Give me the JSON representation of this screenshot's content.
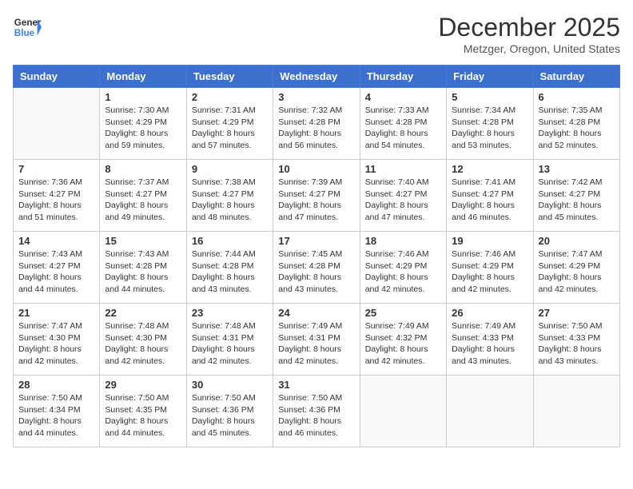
{
  "header": {
    "logo_line1": "General",
    "logo_line2": "Blue",
    "month_title": "December 2025",
    "location": "Metzger, Oregon, United States"
  },
  "days_of_week": [
    "Sunday",
    "Monday",
    "Tuesday",
    "Wednesday",
    "Thursday",
    "Friday",
    "Saturday"
  ],
  "weeks": [
    [
      {
        "day": "",
        "sunrise": "",
        "sunset": "",
        "daylight": ""
      },
      {
        "day": "1",
        "sunrise": "Sunrise: 7:30 AM",
        "sunset": "Sunset: 4:29 PM",
        "daylight": "Daylight: 8 hours and 59 minutes."
      },
      {
        "day": "2",
        "sunrise": "Sunrise: 7:31 AM",
        "sunset": "Sunset: 4:29 PM",
        "daylight": "Daylight: 8 hours and 57 minutes."
      },
      {
        "day": "3",
        "sunrise": "Sunrise: 7:32 AM",
        "sunset": "Sunset: 4:28 PM",
        "daylight": "Daylight: 8 hours and 56 minutes."
      },
      {
        "day": "4",
        "sunrise": "Sunrise: 7:33 AM",
        "sunset": "Sunset: 4:28 PM",
        "daylight": "Daylight: 8 hours and 54 minutes."
      },
      {
        "day": "5",
        "sunrise": "Sunrise: 7:34 AM",
        "sunset": "Sunset: 4:28 PM",
        "daylight": "Daylight: 8 hours and 53 minutes."
      },
      {
        "day": "6",
        "sunrise": "Sunrise: 7:35 AM",
        "sunset": "Sunset: 4:28 PM",
        "daylight": "Daylight: 8 hours and 52 minutes."
      }
    ],
    [
      {
        "day": "7",
        "sunrise": "Sunrise: 7:36 AM",
        "sunset": "Sunset: 4:27 PM",
        "daylight": "Daylight: 8 hours and 51 minutes."
      },
      {
        "day": "8",
        "sunrise": "Sunrise: 7:37 AM",
        "sunset": "Sunset: 4:27 PM",
        "daylight": "Daylight: 8 hours and 49 minutes."
      },
      {
        "day": "9",
        "sunrise": "Sunrise: 7:38 AM",
        "sunset": "Sunset: 4:27 PM",
        "daylight": "Daylight: 8 hours and 48 minutes."
      },
      {
        "day": "10",
        "sunrise": "Sunrise: 7:39 AM",
        "sunset": "Sunset: 4:27 PM",
        "daylight": "Daylight: 8 hours and 47 minutes."
      },
      {
        "day": "11",
        "sunrise": "Sunrise: 7:40 AM",
        "sunset": "Sunset: 4:27 PM",
        "daylight": "Daylight: 8 hours and 47 minutes."
      },
      {
        "day": "12",
        "sunrise": "Sunrise: 7:41 AM",
        "sunset": "Sunset: 4:27 PM",
        "daylight": "Daylight: 8 hours and 46 minutes."
      },
      {
        "day": "13",
        "sunrise": "Sunrise: 7:42 AM",
        "sunset": "Sunset: 4:27 PM",
        "daylight": "Daylight: 8 hours and 45 minutes."
      }
    ],
    [
      {
        "day": "14",
        "sunrise": "Sunrise: 7:43 AM",
        "sunset": "Sunset: 4:27 PM",
        "daylight": "Daylight: 8 hours and 44 minutes."
      },
      {
        "day": "15",
        "sunrise": "Sunrise: 7:43 AM",
        "sunset": "Sunset: 4:28 PM",
        "daylight": "Daylight: 8 hours and 44 minutes."
      },
      {
        "day": "16",
        "sunrise": "Sunrise: 7:44 AM",
        "sunset": "Sunset: 4:28 PM",
        "daylight": "Daylight: 8 hours and 43 minutes."
      },
      {
        "day": "17",
        "sunrise": "Sunrise: 7:45 AM",
        "sunset": "Sunset: 4:28 PM",
        "daylight": "Daylight: 8 hours and 43 minutes."
      },
      {
        "day": "18",
        "sunrise": "Sunrise: 7:46 AM",
        "sunset": "Sunset: 4:29 PM",
        "daylight": "Daylight: 8 hours and 42 minutes."
      },
      {
        "day": "19",
        "sunrise": "Sunrise: 7:46 AM",
        "sunset": "Sunset: 4:29 PM",
        "daylight": "Daylight: 8 hours and 42 minutes."
      },
      {
        "day": "20",
        "sunrise": "Sunrise: 7:47 AM",
        "sunset": "Sunset: 4:29 PM",
        "daylight": "Daylight: 8 hours and 42 minutes."
      }
    ],
    [
      {
        "day": "21",
        "sunrise": "Sunrise: 7:47 AM",
        "sunset": "Sunset: 4:30 PM",
        "daylight": "Daylight: 8 hours and 42 minutes."
      },
      {
        "day": "22",
        "sunrise": "Sunrise: 7:48 AM",
        "sunset": "Sunset: 4:30 PM",
        "daylight": "Daylight: 8 hours and 42 minutes."
      },
      {
        "day": "23",
        "sunrise": "Sunrise: 7:48 AM",
        "sunset": "Sunset: 4:31 PM",
        "daylight": "Daylight: 8 hours and 42 minutes."
      },
      {
        "day": "24",
        "sunrise": "Sunrise: 7:49 AM",
        "sunset": "Sunset: 4:31 PM",
        "daylight": "Daylight: 8 hours and 42 minutes."
      },
      {
        "day": "25",
        "sunrise": "Sunrise: 7:49 AM",
        "sunset": "Sunset: 4:32 PM",
        "daylight": "Daylight: 8 hours and 42 minutes."
      },
      {
        "day": "26",
        "sunrise": "Sunrise: 7:49 AM",
        "sunset": "Sunset: 4:33 PM",
        "daylight": "Daylight: 8 hours and 43 minutes."
      },
      {
        "day": "27",
        "sunrise": "Sunrise: 7:50 AM",
        "sunset": "Sunset: 4:33 PM",
        "daylight": "Daylight: 8 hours and 43 minutes."
      }
    ],
    [
      {
        "day": "28",
        "sunrise": "Sunrise: 7:50 AM",
        "sunset": "Sunset: 4:34 PM",
        "daylight": "Daylight: 8 hours and 44 minutes."
      },
      {
        "day": "29",
        "sunrise": "Sunrise: 7:50 AM",
        "sunset": "Sunset: 4:35 PM",
        "daylight": "Daylight: 8 hours and 44 minutes."
      },
      {
        "day": "30",
        "sunrise": "Sunrise: 7:50 AM",
        "sunset": "Sunset: 4:36 PM",
        "daylight": "Daylight: 8 hours and 45 minutes."
      },
      {
        "day": "31",
        "sunrise": "Sunrise: 7:50 AM",
        "sunset": "Sunset: 4:36 PM",
        "daylight": "Daylight: 8 hours and 46 minutes."
      },
      {
        "day": "",
        "sunrise": "",
        "sunset": "",
        "daylight": ""
      },
      {
        "day": "",
        "sunrise": "",
        "sunset": "",
        "daylight": ""
      },
      {
        "day": "",
        "sunrise": "",
        "sunset": "",
        "daylight": ""
      }
    ]
  ]
}
